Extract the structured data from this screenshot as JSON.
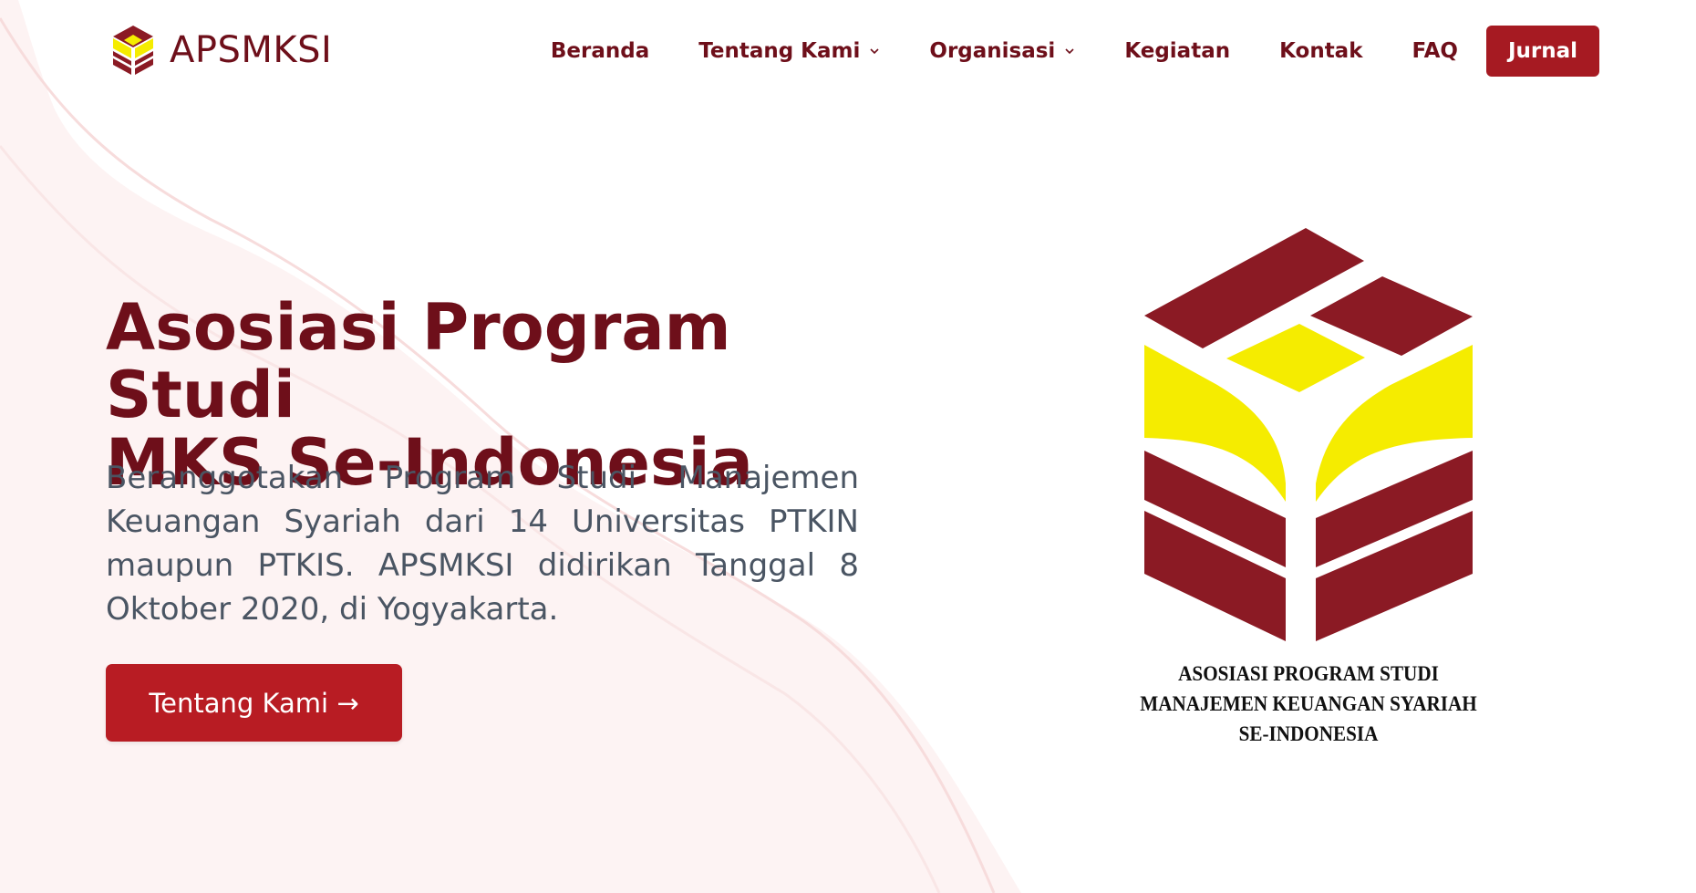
{
  "header": {
    "brand_name": "APSMKSI",
    "nav": [
      {
        "label": "Beranda",
        "dropdown": false
      },
      {
        "label": "Tentang Kami",
        "dropdown": true
      },
      {
        "label": "Organisasi",
        "dropdown": true
      },
      {
        "label": "Kegiatan",
        "dropdown": false
      },
      {
        "label": "Kontak",
        "dropdown": false
      },
      {
        "label": "FAQ",
        "dropdown": false
      }
    ],
    "journal_button": "Jurnal"
  },
  "hero": {
    "title_line1": "Asosiasi Program Studi",
    "title_line2": "MKS Se-Indonesia",
    "description": "Beranggotakan Program Studi Manajemen Keuangan Syariah dari 14 Universitas PTKIN maupun PTKIS. APSMKSI didirikan Tanggal 8 Oktober 2020, di Yogyakarta.",
    "cta_label": "Tentang Kami →"
  },
  "emblem": {
    "caption_line1": "ASOSIASI PROGRAM STUDI",
    "caption_line2": "MANAJEMEN KEUANGAN SYARIAH",
    "caption_line3": "SE-INDONESIA"
  },
  "icons": {
    "brand": "apsmksi-cube-logo-icon",
    "dropdown": "chevron-down-icon"
  },
  "colors": {
    "brand_dark": "#6e0f1a",
    "brand_red": "#b81c23",
    "emblem_red": "#8b1a24",
    "emblem_yellow": "#f5ec00",
    "body_text": "#4a5563"
  }
}
